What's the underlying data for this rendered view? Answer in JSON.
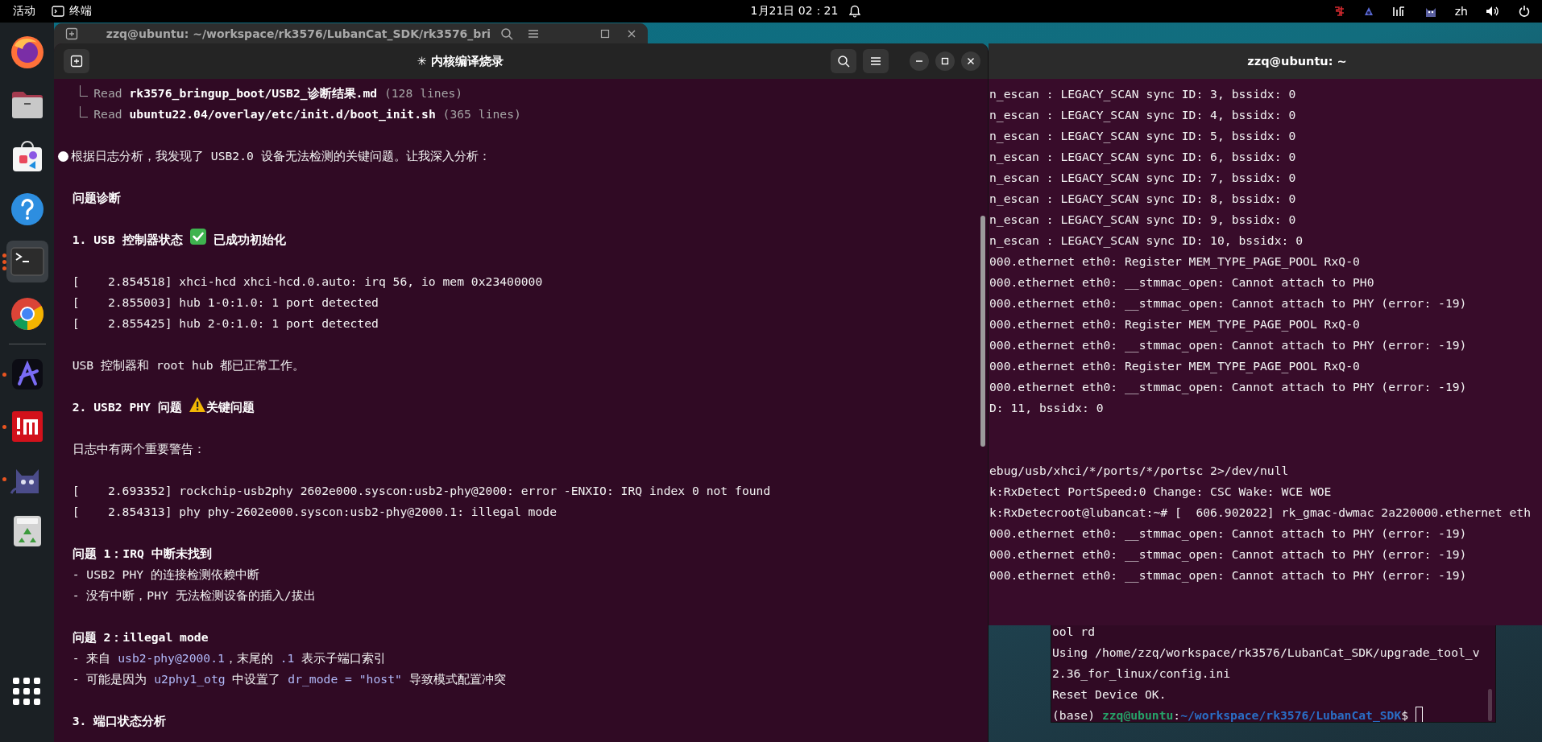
{
  "top_bar": {
    "activities": "活动",
    "app_menu": "终端",
    "clock": "1月21日 02：21",
    "input_method": "zh"
  },
  "dock": {
    "pinned": [
      {
        "kind": "fox",
        "active": false,
        "running": false
      },
      {
        "kind": "files",
        "active": false,
        "running": false
      },
      {
        "kind": "store",
        "active": false,
        "running": false
      },
      {
        "kind": "help",
        "active": false,
        "running": false
      },
      {
        "kind": "terminal",
        "active": true,
        "running": true,
        "several_windows": true
      },
      {
        "kind": "wheel",
        "active": false,
        "running": false
      }
    ],
    "others": [
      {
        "kind": "swoosh",
        "active": false,
        "running": true
      },
      {
        "kind": "redtile",
        "active": false,
        "running": true
      },
      {
        "kind": "cat",
        "active": false,
        "running": true
      },
      {
        "kind": "trash",
        "active": false,
        "running": false
      }
    ]
  },
  "background_window": {
    "title": "zzq@ubuntu: ~/workspace/rk3576/LubanCat_SDK/rk3576_bri"
  },
  "main_window": {
    "title": "✳ 内核编译烧录",
    "blocks": [
      [
        {
          "kind": "tool",
          "spans": [
            {
              "kind": "dim",
              "text": "Read "
            },
            {
              "kind": "bold",
              "text": "rk3576_bringup_boot/USB2_诊断结果.md"
            },
            {
              "kind": "dim",
              "text": " (128 lines)"
            }
          ]
        },
        {
          "kind": "tool",
          "spans": [
            {
              "kind": "dim",
              "text": "Read "
            },
            {
              "kind": "bold",
              "text": "ubuntu22.04/overlay/etc/init.d/boot_init.sh"
            },
            {
              "kind": "dim",
              "text": " (365 lines)"
            }
          ]
        }
      ],
      [
        {
          "kind": "bullet",
          "spans": [
            {
              "kind": "plain",
              "text": "根据日志分析，我发现了 USB2.0 设备无法检测的关键问题。让我深入分析："
            }
          ]
        }
      ],
      [
        {
          "kind": "text",
          "spans": [
            {
              "kind": "bold",
              "text": "问题诊断"
            }
          ]
        }
      ],
      [
        {
          "kind": "text",
          "spans": [
            {
              "kind": "bold",
              "text": "1. USB 控制器状态"
            },
            {
              "kind": "check"
            },
            {
              "kind": "bold",
              "text": "已成功初始化"
            }
          ]
        }
      ],
      [
        {
          "kind": "text",
          "spans": [
            {
              "kind": "plain",
              "text": "[    2.854518] xhci-hcd xhci-hcd.0.auto: irq 56, io mem 0x23400000"
            }
          ]
        },
        {
          "kind": "text",
          "spans": [
            {
              "kind": "plain",
              "text": "[    2.855003] hub 1-0:1.0: 1 port detected"
            }
          ]
        },
        {
          "kind": "text",
          "spans": [
            {
              "kind": "plain",
              "text": "[    2.855425] hub 2-0:1.0: 1 port detected"
            }
          ]
        }
      ],
      [
        {
          "kind": "text",
          "spans": [
            {
              "kind": "plain",
              "text": "USB 控制器和 root hub 都已正常工作。"
            }
          ]
        }
      ],
      [
        {
          "kind": "text",
          "spans": [
            {
              "kind": "bold",
              "text": "2. USB2 PHY 问题"
            },
            {
              "kind": "warning"
            },
            {
              "kind": "bold",
              "text": "关键问题"
            }
          ]
        }
      ],
      [
        {
          "kind": "text",
          "spans": [
            {
              "kind": "plain",
              "text": "日志中有两个重要警告："
            }
          ]
        }
      ],
      [
        {
          "kind": "text",
          "spans": [
            {
              "kind": "plain",
              "text": "[    2.693352] rockchip-usb2phy 2602e000.syscon:usb2-phy@2000: error -ENXIO: IRQ index 0 not found"
            }
          ]
        },
        {
          "kind": "text",
          "spans": [
            {
              "kind": "plain",
              "text": "[    2.854313] phy phy-2602e000.syscon:usb2-phy@2000.1: illegal mode"
            }
          ]
        }
      ],
      [
        {
          "kind": "text",
          "spans": [
            {
              "kind": "bold",
              "text": "问题 1：IRQ 中断未找到"
            }
          ]
        },
        {
          "kind": "text",
          "spans": [
            {
              "kind": "plain",
              "text": "- USB2 PHY 的连接检测依赖中断"
            }
          ]
        },
        {
          "kind": "text",
          "spans": [
            {
              "kind": "plain",
              "text": "- 没有中断，PHY 无法检测设备的插入/拔出"
            }
          ]
        }
      ],
      [
        {
          "kind": "text",
          "spans": [
            {
              "kind": "bold",
              "text": "问题 2：illegal mode"
            }
          ]
        },
        {
          "kind": "text",
          "spans": [
            {
              "kind": "plain",
              "text": "- 来自 "
            },
            {
              "kind": "code",
              "text": "usb2-phy@2000.1"
            },
            {
              "kind": "plain",
              "text": "，末尾的 "
            },
            {
              "kind": "code",
              "text": ".1"
            },
            {
              "kind": "plain",
              "text": " 表示子端口索引"
            }
          ]
        },
        {
          "kind": "text",
          "spans": [
            {
              "kind": "plain",
              "text": "- 可能是因为 "
            },
            {
              "kind": "code",
              "text": "u2phy1_otg"
            },
            {
              "kind": "plain",
              "text": " 中设置了 "
            },
            {
              "kind": "code",
              "text": "dr_mode = \"host\""
            },
            {
              "kind": "plain",
              "text": " 导致模式配置冲突"
            }
          ]
        }
      ],
      [
        {
          "kind": "text",
          "spans": [
            {
              "kind": "bold",
              "text": "3. 端口状态分析"
            }
          ]
        }
      ]
    ]
  },
  "right_window": {
    "title": "zzq@ubuntu: ~",
    "blocks": [
      [
        "n_escan : LEGACY_SCAN sync ID: 3, bssidx: 0",
        "n_escan : LEGACY_SCAN sync ID: 4, bssidx: 0",
        "n_escan : LEGACY_SCAN sync ID: 5, bssidx: 0",
        "n_escan : LEGACY_SCAN sync ID: 6, bssidx: 0",
        "n_escan : LEGACY_SCAN sync ID: 7, bssidx: 0",
        "n_escan : LEGACY_SCAN sync ID: 8, bssidx: 0",
        "n_escan : LEGACY_SCAN sync ID: 9, bssidx: 0",
        "n_escan : LEGACY_SCAN sync ID: 10, bssidx: 0",
        "000.ethernet eth0: Register MEM_TYPE_PAGE_POOL RxQ-0",
        "000.ethernet eth0: __stmmac_open: Cannot attach to PH0",
        "000.ethernet eth0: __stmmac_open: Cannot attach to PHY (error: -19)",
        "000.ethernet eth0: Register MEM_TYPE_PAGE_POOL RxQ-0",
        "000.ethernet eth0: __stmmac_open: Cannot attach to PHY (error: -19)",
        "000.ethernet eth0: Register MEM_TYPE_PAGE_POOL RxQ-0",
        "000.ethernet eth0: __stmmac_open: Cannot attach to PHY (error: -19)",
        "D: 11, bssidx: 0"
      ],
      [
        "ebug/usb/xhci/*/ports/*/portsc 2>/dev/null",
        "k:RxDetect PortSpeed:0 Change: CSC Wake: WCE WOE",
        "k:RxDetecroot@lubancat:~# [  606.902022] rk_gmac-dwmac 2a220000.ethernet eth",
        "000.ethernet eth0: __stmmac_open: Cannot attach to PHY (error: -19)",
        "000.ethernet eth0: __stmmac_open: Cannot attach to PHY (error: -19)",
        "000.ethernet eth0: __stmmac_open: Cannot attach to PHY (error: -19)"
      ]
    ]
  },
  "bottom_window": {
    "lines": [
      "ool rd",
      "Using /home/zzq/workspace/rk3576/LubanCat_SDK/upgrade_tool_v",
      "2.36_for_linux/config.ini",
      "Reset Device OK."
    ],
    "prompt": {
      "env": "(base)",
      "user": "zzq@ubuntu",
      "separator": ":",
      "path": "~/workspace/rk3576/LubanCat_SDK",
      "symbol": "$"
    },
    "cursor": true
  }
}
